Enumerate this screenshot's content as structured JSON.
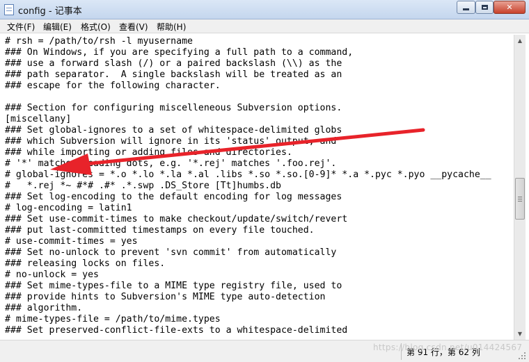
{
  "window": {
    "title": "config - 记事本",
    "icon": "notepad-icon",
    "controls": {
      "minimize_icon": "minimize-icon",
      "maximize_icon": "maximize-icon",
      "close_label": "✕"
    }
  },
  "menu": {
    "items": [
      {
        "label": "文件(F)"
      },
      {
        "label": "编辑(E)"
      },
      {
        "label": "格式(O)"
      },
      {
        "label": "查看(V)"
      },
      {
        "label": "帮助(H)"
      }
    ]
  },
  "editor": {
    "lines": [
      "# rsh = /path/to/rsh -l myusername",
      "### On Windows, if you are specifying a full path to a command,",
      "### use a forward slash (/) or a paired backslash (\\\\) as the",
      "### path separator.  A single backslash will be treated as an",
      "### escape for the following character.",
      "",
      "### Section for configuring miscelleneous Subversion options.",
      "[miscellany]",
      "### Set global-ignores to a set of whitespace-delimited globs",
      "### which Subversion will ignore in its 'status' output, and",
      "### while importing or adding files and directories.",
      "# '*' matches leading dots, e.g. '*.rej' matches '.foo.rej'.",
      "# global-ignores = *.o *.lo *.la *.al .libs *.so *.so.[0-9]* *.a *.pyc *.pyo __pycache__",
      "#   *.rej *~ #*# .#* .*.swp .DS_Store [Tt]humbs.db",
      "### Set log-encoding to the default encoding for log messages",
      "# log-encoding = latin1",
      "### Set use-commit-times to make checkout/update/switch/revert",
      "### put last-committed timestamps on every file touched.",
      "# use-commit-times = yes",
      "### Set no-unlock to prevent 'svn commit' from automatically",
      "### releasing locks on files.",
      "# no-unlock = yes",
      "### Set mime-types-file to a MIME type registry file, used to",
      "### provide hints to Subversion's MIME type auto-detection",
      "### algorithm.",
      "# mime-types-file = /path/to/mime.types",
      "### Set preserved-conflict-file-exts to a whitespace-delimited"
    ]
  },
  "scrollbar": {
    "up_icon": "scroll-up-arrow-icon",
    "down_icon": "scroll-down-arrow-icon"
  },
  "status": {
    "position": "第 91 行，第 62 列",
    "watermark": "https://blog.csdn.net/u014424567"
  },
  "annotation": {
    "icon": "red-arrow-icon",
    "color": "#e8232a"
  }
}
